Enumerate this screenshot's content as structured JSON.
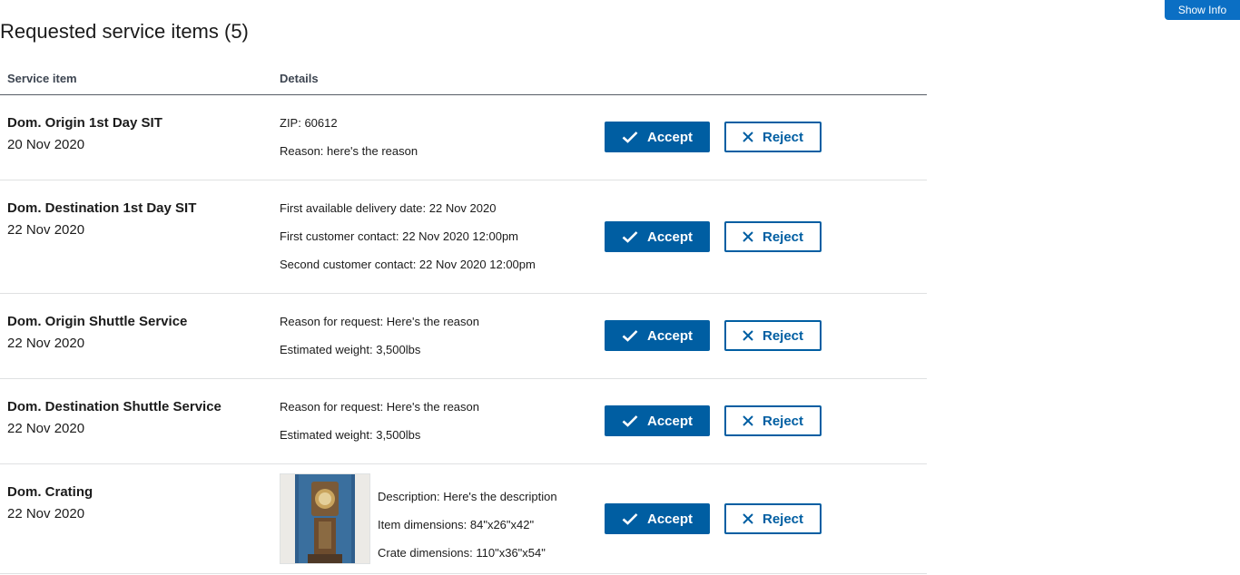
{
  "header": {
    "show_info_label": "Show Info"
  },
  "page": {
    "title": "Requested service items (5)"
  },
  "table": {
    "headers": [
      "Service item",
      "Details"
    ],
    "accept_label": "Accept",
    "reject_label": "Reject",
    "rows": [
      {
        "name": "Dom. Origin 1st Day SIT",
        "date": "20 Nov 2020",
        "details": [
          "ZIP: 60612",
          "Reason: here's the reason"
        ]
      },
      {
        "name": "Dom. Destination 1st Day SIT",
        "date": "22 Nov 2020",
        "details": [
          "First available delivery date: 22 Nov 2020",
          "First customer contact: 22 Nov 2020 12:00pm",
          "Second customer contact: 22 Nov 2020 12:00pm"
        ]
      },
      {
        "name": "Dom. Origin Shuttle Service",
        "date": "22 Nov 2020",
        "details": [
          "Reason for request: Here's the reason",
          "Estimated weight: 3,500lbs"
        ]
      },
      {
        "name": "Dom. Destination Shuttle Service",
        "date": "22 Nov 2020",
        "details": [
          "Reason for request: Here's the reason",
          "Estimated weight: 3,500lbs"
        ]
      },
      {
        "name": "Dom. Crating",
        "date": "22 Nov 2020",
        "details": [
          "Description: Here's the description",
          "Item dimensions: 84\"x26\"x42\"",
          "Crate dimensions: 110\"x36\"x54\""
        ]
      }
    ]
  },
  "colors": {
    "primary": "#005ea2",
    "show_info_bg": "#0b6fc4",
    "row_border": "#dfe1e2"
  },
  "icons": {
    "accept": "check-icon",
    "reject": "close-icon",
    "crate_image": "grandfather-clock-photo"
  }
}
